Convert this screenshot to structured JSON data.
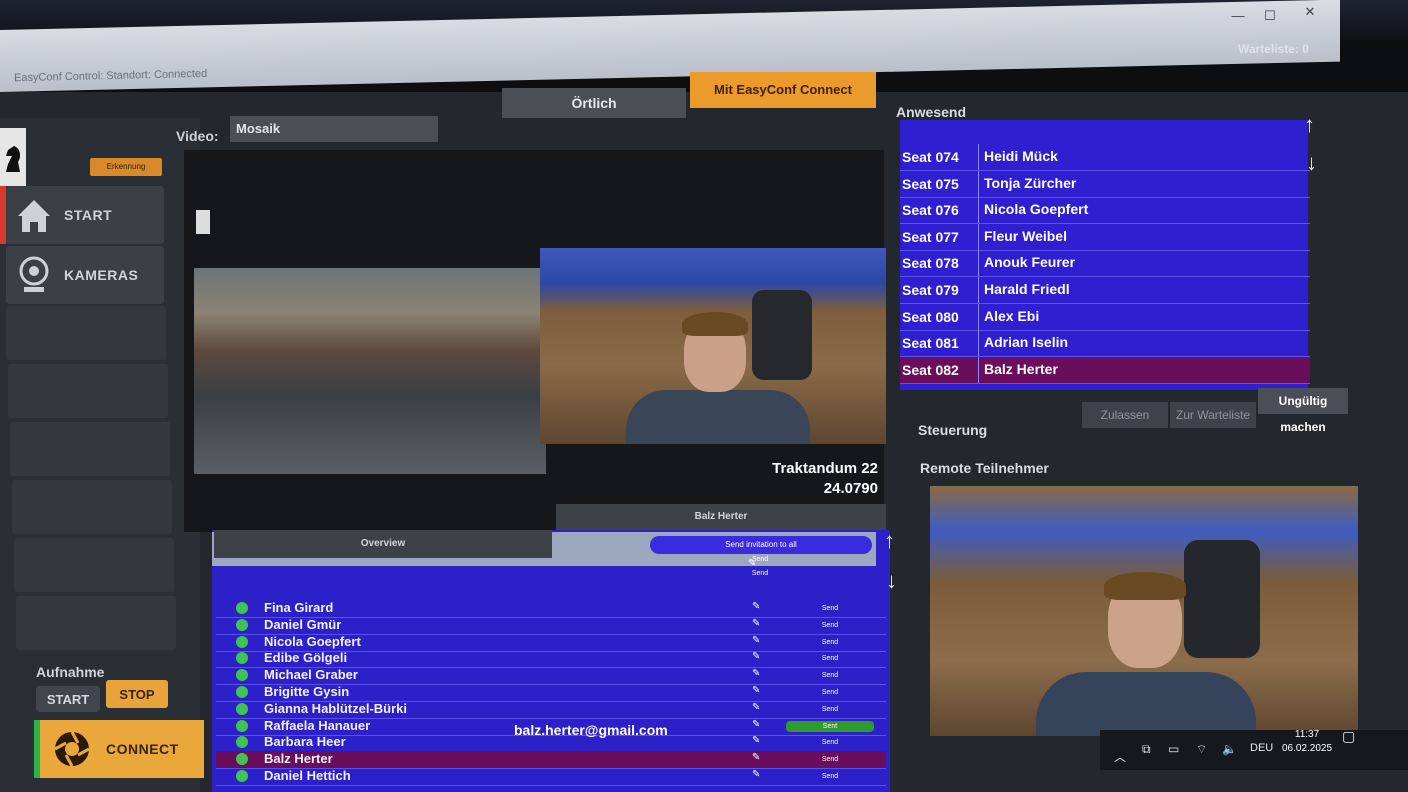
{
  "window": {
    "title": "EasyConf Control: Standort: Connected",
    "minimize": "—",
    "maximize": "☐",
    "close": "✕",
    "warteliste_label": "Warteliste:",
    "warteliste_count": "0"
  },
  "sidebar": {
    "badge": "Erkennung",
    "items": [
      {
        "label": "START",
        "icon": "home-icon"
      },
      {
        "label": "KAMERAS",
        "icon": "webcam-icon"
      }
    ],
    "aufnahme": {
      "label": "Aufnahme",
      "start": "START",
      "stop": "STOP"
    },
    "connect": "CONNECT"
  },
  "video": {
    "label": "Video:",
    "mode": "Mosaik",
    "tab_oertlich": "Örtlich",
    "tab_connect": "Mit EasyConf Connect",
    "traktandum": "Traktandum 22",
    "traktandum_number": "24.0790",
    "overview": "Overview",
    "speaker": "Balz Herter"
  },
  "participants": {
    "invite_all": "Send invitation to all",
    "send_label": "Send",
    "sent_label": "Sent",
    "email": "balz.herter@gmail.com",
    "rows": [
      {
        "name": "Fina Girard"
      },
      {
        "name": "Daniel Gmür"
      },
      {
        "name": "Nicola Goepfert"
      },
      {
        "name": "Edibe Gölgeli"
      },
      {
        "name": "Michael Graber"
      },
      {
        "name": "Brigitte Gysin"
      },
      {
        "name": "Gianna Hablützel-Bürki"
      },
      {
        "name": "Raffaela Hanauer"
      },
      {
        "name": "Barbara Heer"
      },
      {
        "name": "Balz Herter"
      },
      {
        "name": "Daniel Hettich"
      }
    ]
  },
  "anwesend": {
    "label": "Anwesend",
    "seats": [
      {
        "seat": "Seat 074",
        "name": "Heidi Mück"
      },
      {
        "seat": "Seat 075",
        "name": "Tonja Zürcher"
      },
      {
        "seat": "Seat 076",
        "name": "Nicola Goepfert"
      },
      {
        "seat": "Seat 077",
        "name": "Fleur Weibel"
      },
      {
        "seat": "Seat 078",
        "name": "Anouk Feurer"
      },
      {
        "seat": "Seat 079",
        "name": "Harald Friedl"
      },
      {
        "seat": "Seat 080",
        "name": "Alex Ebi"
      },
      {
        "seat": "Seat 081",
        "name": "Adrian Iselin"
      },
      {
        "seat": "Seat 082",
        "name": "Balz Herter"
      }
    ]
  },
  "steuerung": {
    "label": "Steuerung",
    "zulassen": "Zulassen",
    "zur_warteliste": "Zur Warteliste",
    "ungueltig": "Ungültig machen"
  },
  "remote": {
    "label": "Remote Teilnehmer"
  },
  "taskbar": {
    "language": "DEU",
    "time": "11:37",
    "date": "06.02.2025"
  },
  "colors": {
    "accent": "#eb9a2c",
    "list_bg": "#2c20c8",
    "selected_row": "#6a0e5c",
    "online": "#3ec454"
  }
}
